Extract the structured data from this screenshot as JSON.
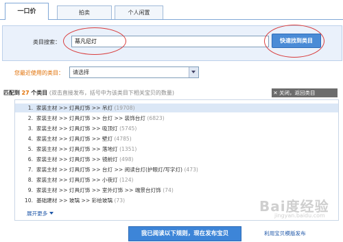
{
  "tabs": [
    {
      "label": "一口价",
      "active": true
    },
    {
      "label": "拍卖",
      "active": false
    },
    {
      "label": "个人闲置",
      "active": false
    }
  ],
  "search": {
    "label": "类目搜索：",
    "value": "蒂凡尼灯",
    "button": "快速找到类目"
  },
  "recent": {
    "label": "您最近使用的类目：",
    "selected": "请选择"
  },
  "match": {
    "prefix": "匹配到",
    "count": "27",
    "suffix": "个类目",
    "hint": "(双击直接发布，括号中为该类目下相关宝贝的数量)",
    "close": "关闭，返回类目"
  },
  "results": [
    {
      "num": "1.",
      "path": "家装主材 >> 灯具灯饰 >> 吊灯",
      "count": "(19708)"
    },
    {
      "num": "2.",
      "path": "家装主材 >> 灯具灯饰 >> 台灯 >> 装饰台灯",
      "count": "(6823)"
    },
    {
      "num": "3.",
      "path": "家装主材 >> 灯具灯饰 >> 吸顶灯",
      "count": "(5745)"
    },
    {
      "num": "4.",
      "path": "家装主材 >> 灯具灯饰 >> 壁灯",
      "count": "(4785)"
    },
    {
      "num": "5.",
      "path": "家装主材 >> 灯具灯饰 >> 落地灯",
      "count": "(1351)"
    },
    {
      "num": "6.",
      "path": "家装主材 >> 灯具灯饰 >> 镜前灯",
      "count": "(498)"
    },
    {
      "num": "7.",
      "path": "家装主材 >> 灯具灯饰 >> 台灯 >> 阅读台灯(护眼灯/写字灯)",
      "count": "(473)"
    },
    {
      "num": "8.",
      "path": "家装主材 >> 灯具灯饰 >> 小夜灯",
      "count": "(124)"
    },
    {
      "num": "9.",
      "path": "家装主材 >> 灯具灯饰 >> 室外灯饰 >> 端景台灯饰",
      "count": "(74)"
    },
    {
      "num": "10.",
      "path": "基础建材 >> 玻璃 >> 彩绘玻璃",
      "count": "(73)"
    }
  ],
  "expand_more": "展开更多",
  "publish_button": "我已阅读以下规则，现在发布宝贝",
  "template_link": "利用宝贝模版发布",
  "watermark": {
    "title": "Bai度经验",
    "sub": "jingyan.baidu.com"
  },
  "colors": {
    "accent": "#e06d00",
    "link": "#1f57a8",
    "button": "#3d85d8",
    "annotation": "#d83a3a"
  }
}
